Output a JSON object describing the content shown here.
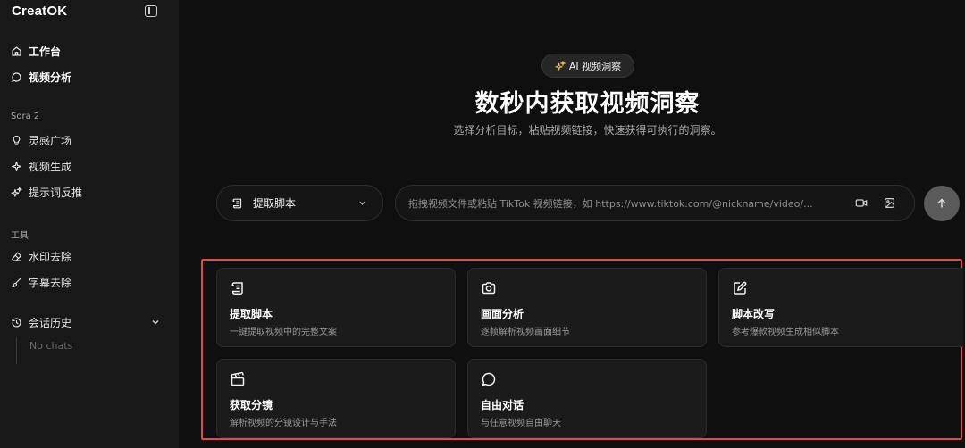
{
  "sidebar": {
    "logo": "CreatOK",
    "main_items": [
      {
        "label": "工作台",
        "icon": "home-icon"
      },
      {
        "label": "视频分析",
        "icon": "chat-bubble-icon"
      }
    ],
    "section_sora": "Sora 2",
    "sora_items": [
      {
        "label": "灵感广场",
        "icon": "lightbulb-icon"
      },
      {
        "label": "视频生成",
        "icon": "sparkle-icon"
      },
      {
        "label": "提示词反推",
        "icon": "sparkles-icon"
      }
    ],
    "section_tools": "工具",
    "tool_items": [
      {
        "label": "水印去除",
        "icon": "eraser-icon"
      },
      {
        "label": "字幕去除",
        "icon": "brush-icon"
      }
    ],
    "history_label": "会话历史",
    "history_empty": "No chats"
  },
  "hero": {
    "badge": "AI 视频洞察",
    "title": "数秒内获取视频洞察",
    "subtitle": "选择分析目标，粘贴视频链接，快速获得可执行的洞察。"
  },
  "composer": {
    "mode": "提取脚本",
    "placeholder": "拖拽视频文件或粘贴 TikTok 视频链接，如 https://www.tiktok.com/@nickname/video/..."
  },
  "cards": [
    {
      "title": "提取脚本",
      "desc": "一键提取视频中的完整文案",
      "icon": "script-icon"
    },
    {
      "title": "画面分析",
      "desc": "逐帧解析视频画面细节",
      "icon": "camera-icon"
    },
    {
      "title": "脚本改写",
      "desc": "参考爆款视频生成相似脚本",
      "icon": "edit-icon"
    },
    {
      "title": "获取分镜",
      "desc": "解析视频的分镜设计与手法",
      "icon": "clapperboard-icon"
    },
    {
      "title": "自由对话",
      "desc": "与任意视频自由聊天",
      "icon": "chat-icon"
    }
  ],
  "colors": {
    "background": "#0f0f0f",
    "sidebar": "#181818",
    "highlight": "#e24a4a",
    "badge_icon": "#f0c24b"
  }
}
